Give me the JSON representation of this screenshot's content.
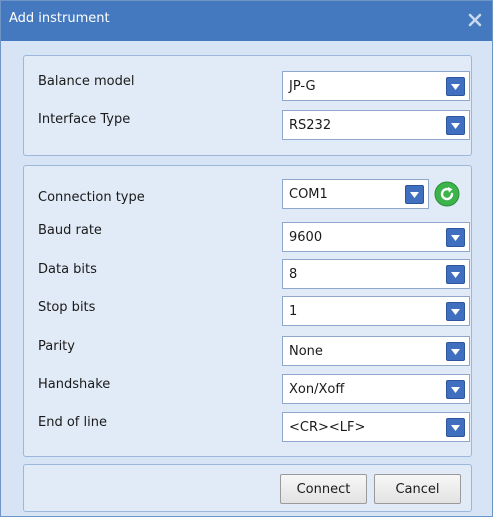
{
  "window": {
    "title": "Add instrument",
    "close_icon": "close-icon"
  },
  "instrument": {
    "balance_model": {
      "label": "Balance model",
      "value": "JP-G"
    },
    "interface_type": {
      "label": "Interface Type",
      "value": "RS232"
    }
  },
  "connection": {
    "connection_type": {
      "label": "Connection type",
      "value": "COM1"
    },
    "baud_rate": {
      "label": "Baud rate",
      "value": "9600"
    },
    "data_bits": {
      "label": "Data bits",
      "value": "8"
    },
    "stop_bits": {
      "label": "Stop bits",
      "value": "1"
    },
    "parity": {
      "label": "Parity",
      "value": "None"
    },
    "handshake": {
      "label": "Handshake",
      "value": "Xon/Xoff"
    },
    "end_of_line": {
      "label": "End of line",
      "value": "<CR><LF>"
    }
  },
  "actions": {
    "connect_label": "Connect",
    "cancel_label": "Cancel"
  },
  "colors": {
    "titlebar": "#4479c0",
    "dialog_background": "#d6e4f5",
    "panel_background": "#e1ebf7",
    "dropdown_button": "#3f6fbe",
    "refresh_green": "#3cb44b"
  }
}
